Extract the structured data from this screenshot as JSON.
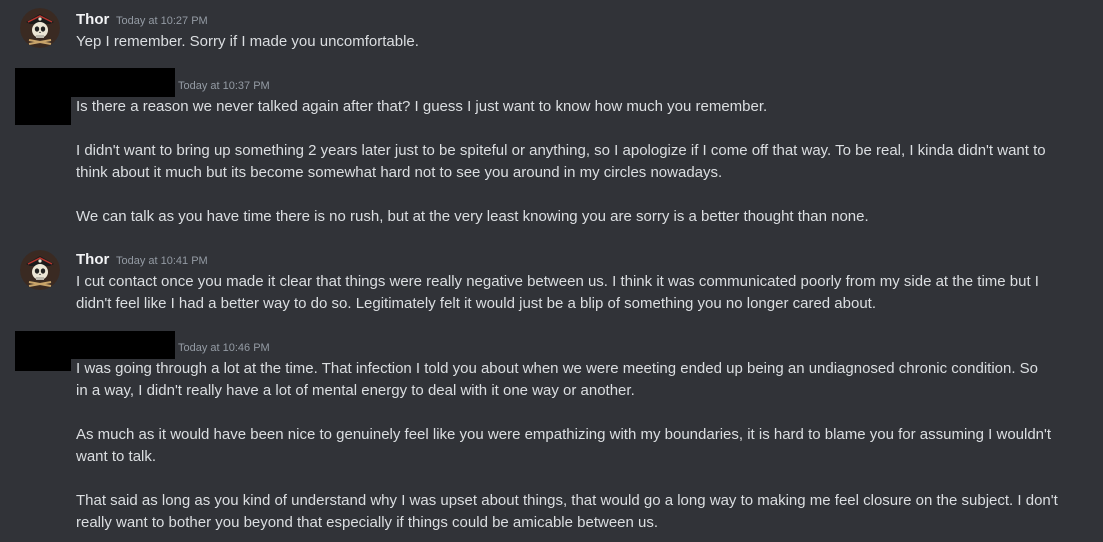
{
  "messages": [
    {
      "author": "Thor",
      "timestamp": "Today at 10:27 PM",
      "lines": [
        "Yep I remember. Sorry if I made you uncomfortable."
      ]
    },
    {
      "author": "",
      "timestamp": "Today at 10:37 PM",
      "lines": [
        "Is there a reason we never talked again after that? I guess I just want to know how much you remember.",
        "I didn't want to bring up something 2 years later just to be spiteful or anything, so I apologize if I come off that way. To be real, I kinda didn't want to",
        "think about it much but its become somewhat hard not to see you around in my circles nowadays.",
        "We can talk as you have time there is no rush, but at the very least knowing you are sorry is a better thought than none."
      ]
    },
    {
      "author": "Thor",
      "timestamp": "Today at 10:41 PM",
      "lines": [
        "I cut contact once you made it clear that things were really negative between us. I think it was communicated poorly from my side at the time but I",
        "didn't feel like I had a better way to do so. Legitimately felt it would just be a blip of something you no longer cared about."
      ]
    },
    {
      "author": "",
      "timestamp": "Today at 10:46 PM",
      "lines": [
        "I was going through a lot at the time. That infection I told you about when we were meeting ended up being an undiagnosed chronic condition. So",
        "in a way, I didn't really have a lot of mental energy to deal with it one way or another.",
        "As much as it would have been nice to genuinely feel like you were empathizing with my boundaries, it is hard to blame you for assuming I wouldn't",
        "want to talk.",
        "That said as long as you kind of understand why I was upset about things, that would go a long way to making me feel closure on the subject. I don't",
        "really want to bother you beyond that especially if things could be amicable between us."
      ]
    }
  ]
}
